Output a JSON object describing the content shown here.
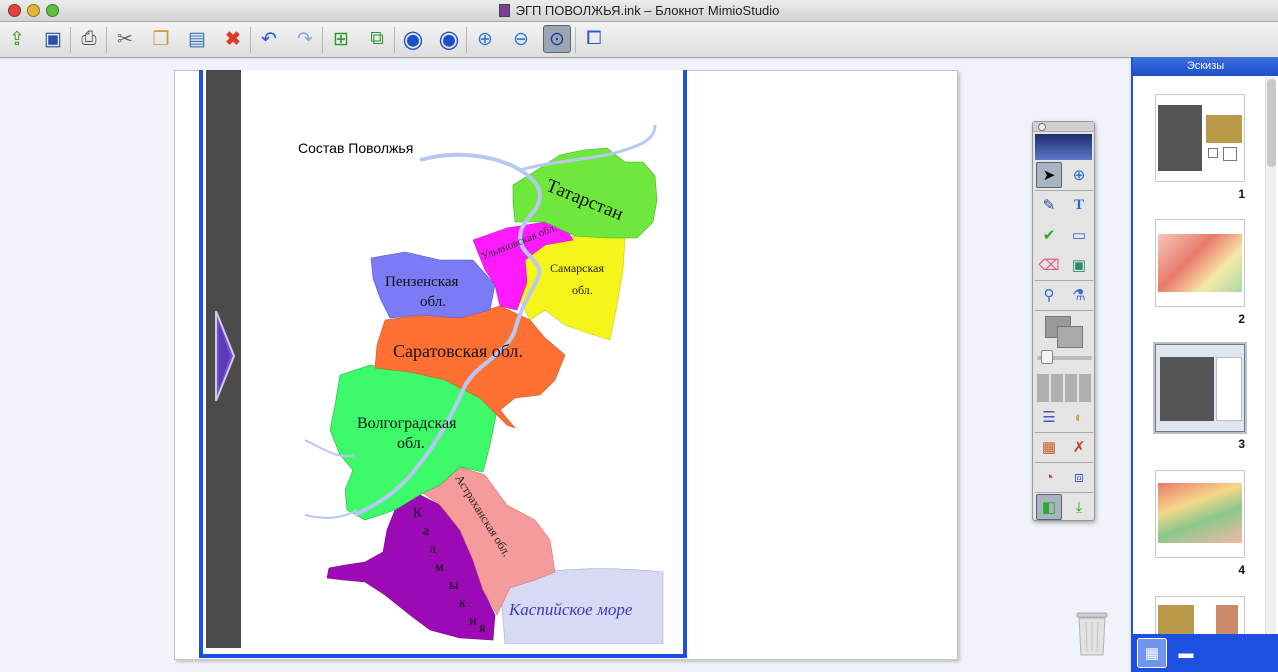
{
  "window": {
    "title": "ЭГП ПОВОЛЖЬЯ.ink – Блокнот MimioStudio",
    "buttons": [
      "close",
      "minimize",
      "zoom"
    ]
  },
  "toolbar": {
    "items": [
      {
        "name": "open-icon",
        "glyph": "⇪"
      },
      {
        "name": "save-icon",
        "glyph": "💾"
      },
      {
        "name": "print-icon",
        "glyph": "🖶"
      },
      {
        "name": "cut-icon",
        "glyph": "✂"
      },
      {
        "name": "copy-icon",
        "glyph": "❐"
      },
      {
        "name": "paste-icon",
        "glyph": "📋"
      },
      {
        "name": "delete-icon",
        "glyph": "✖"
      },
      {
        "name": "undo-icon",
        "glyph": "↶"
      },
      {
        "name": "redo-icon",
        "glyph": "↷"
      },
      {
        "name": "new-page-icon",
        "glyph": "⊕"
      },
      {
        "name": "duplicate-page-icon",
        "glyph": "⧉"
      },
      {
        "name": "previous-page-icon",
        "glyph": "◀"
      },
      {
        "name": "next-page-icon",
        "glyph": "▶"
      },
      {
        "name": "zoom-in-icon",
        "glyph": "⊕"
      },
      {
        "name": "zoom-out-icon",
        "glyph": "⊖"
      },
      {
        "name": "zoom-fit-icon",
        "glyph": "⊙"
      },
      {
        "name": "screen-mode-icon",
        "glyph": "⧠"
      }
    ]
  },
  "map": {
    "caption": "Состав Поволжья",
    "regions": {
      "tatarstan": "Татарстан",
      "ulyanovsk": "Ульяновская обл.",
      "samara_1": "Самарская",
      "samara_2": "обл.",
      "penza_1": "Пензенская",
      "penza_2": "обл.",
      "saratov": "Саратовская обл.",
      "volgograd_1": "Волгоградская",
      "volgograd_2": "обл.",
      "astrakhan": "Астраханская обл.",
      "kalmykia_letters": [
        "К",
        "а",
        "л",
        "м",
        "ы",
        "к",
        "и",
        "я"
      ],
      "caspian": "Каспийское море"
    }
  },
  "sidebar": {
    "header": "Эскизы",
    "thumbnails": [
      "1",
      "2",
      "3",
      "4"
    ]
  },
  "colors": {
    "accent": "#1d4fe0",
    "tatarstan": "#6ee83c",
    "ulyanovsk": "#ff1aff",
    "samara": "#f5f51a",
    "penza": "#7b7bf5",
    "saratov": "#ff7032",
    "volgograd": "#3cfa6a",
    "astrakhan": "#f59b9b",
    "kalmykia": "#9b0ab4",
    "caspian": "#d8daf5"
  }
}
